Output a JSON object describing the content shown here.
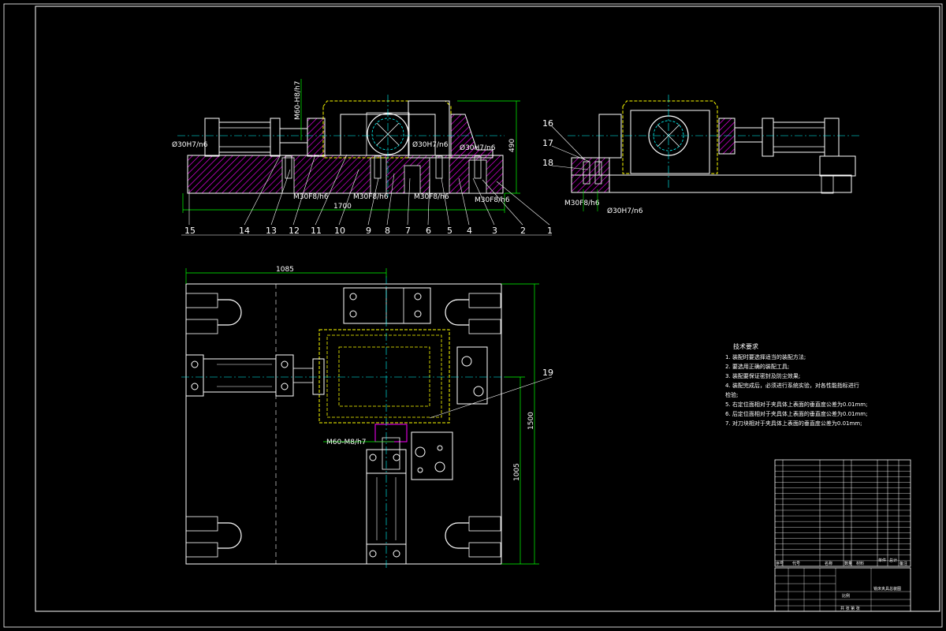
{
  "colors": {
    "background": "#000000",
    "frame": "#ffffff",
    "outline": "#ffffff",
    "dimension": "#00ff00",
    "centerline": "#00ffff",
    "hidden": "#ffff00",
    "hatch": "#ff00ff",
    "table": "#ffffff"
  },
  "front_view": {
    "callouts": [
      "1",
      "2",
      "3",
      "4",
      "5",
      "6",
      "7",
      "8",
      "9",
      "10",
      "11",
      "12",
      "13",
      "14",
      "15"
    ],
    "dims": {
      "overall_width": "1700",
      "height": "490",
      "fit_top": "M60-H8/h7",
      "fit_left": "Ø30H7/n6",
      "fit_mid": "Ø30H7/n6",
      "fit_right": "Ø30H7/n6",
      "thread_1": "M30F8/h6",
      "thread_2": "M30F8/h6",
      "thread_3": "M30F8/h6",
      "thread_4": "M30F8/h6"
    }
  },
  "side_view": {
    "callouts": [
      "16",
      "17",
      "18"
    ],
    "dims": {
      "thread": "M30F8/h6",
      "fit": "Ø30H7/n6"
    }
  },
  "plan_view": {
    "callout": "19",
    "dims": {
      "width_top": "1085",
      "height_right": "1500",
      "height_inner": "1005",
      "fit_bottom": "M60-M8/h7"
    }
  },
  "technical_requirements": {
    "title": "技术要求",
    "items": [
      "1. 装配时要选择适当的装配方法;",
      "2. 要选用正确的装配工具;",
      "3. 装配要保证密封及防尘效果;",
      "4. 装配完成后，必须进行系统实验，对各性能指标进行",
      "   检验;",
      "5. 右定位面相对于夹具体上表面的垂直度公差为0.01mm;",
      "6. 后定位面相对于夹具体上表面的垂直度公差为0.01mm;",
      "7. 对刀块相对于夹具体上表面的垂直度公差为0.01mm;"
    ]
  },
  "title_block": {
    "header": [
      "序号",
      "代号",
      "名称",
      "数量",
      "材料",
      "单件",
      "总计",
      "备注"
    ],
    "drawing_name": "铣床夹具总装图",
    "scale_label": "比例",
    "sheet_label": "共 张 第 张"
  }
}
